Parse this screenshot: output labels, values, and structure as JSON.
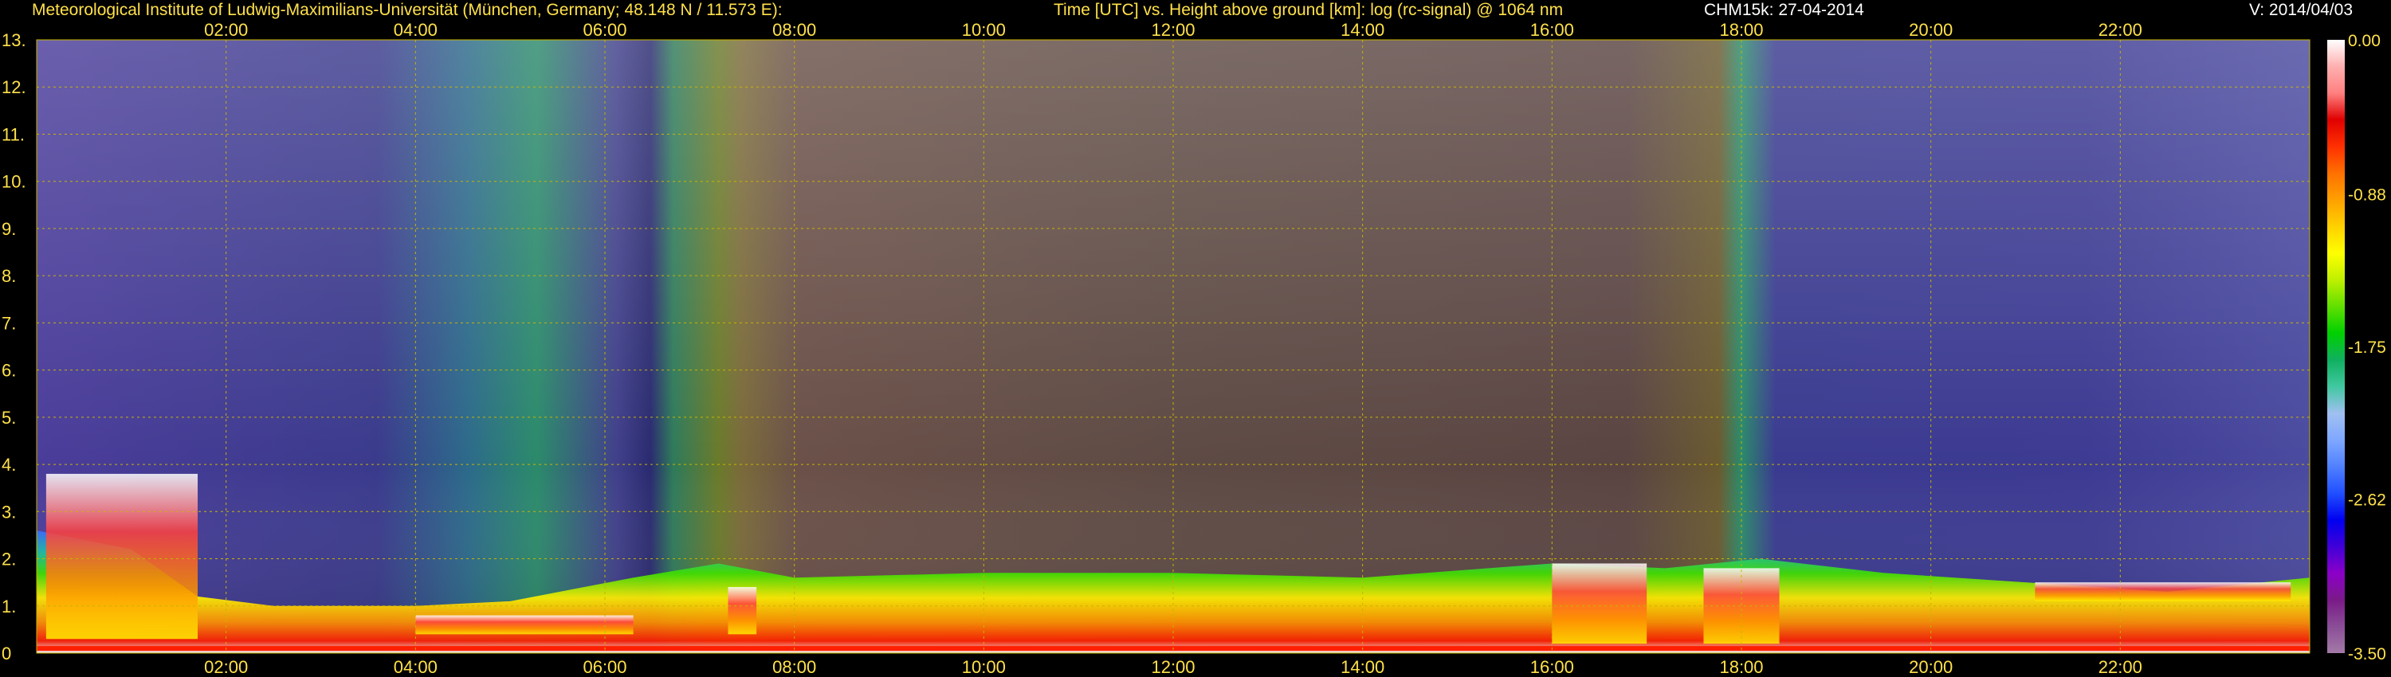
{
  "header": {
    "institute": "Meteorological Institute of Ludwig-Maximilians-Universität (München, Germany; 48.148 N / 11.573 E):",
    "axes_desc": "Time [UTC] vs. Height above ground [km]: log (rc-signal) @ 1064 nm",
    "device": "CHM15k: 27-04-2014",
    "version": "V: 2014/04/03"
  },
  "colors": {
    "axis_text": "#ffe14a",
    "grid": "#c8b400",
    "background": "#000000"
  },
  "chart_data": {
    "type": "heatmap",
    "title": "Time [UTC] vs. Height above ground [km]: log (rc-signal) @ 1064 nm",
    "xlabel": "Time [UTC]",
    "ylabel": "Height above ground [km]",
    "xlim_hours": [
      0,
      24
    ],
    "ylim_km": [
      0,
      13
    ],
    "x_ticks": [
      "02:00",
      "04:00",
      "06:00",
      "08:00",
      "10:00",
      "12:00",
      "14:00",
      "16:00",
      "18:00",
      "20:00",
      "22:00"
    ],
    "x_tick_hours": [
      2,
      4,
      6,
      8,
      10,
      12,
      14,
      16,
      18,
      20,
      22
    ],
    "y_ticks": [
      "0",
      "1.",
      "2.",
      "3.",
      "4.",
      "5.",
      "6.",
      "7.",
      "8.",
      "9.",
      "10.",
      "11.",
      "12.",
      "13."
    ],
    "y_tick_values": [
      0,
      1,
      2,
      3,
      4,
      5,
      6,
      7,
      8,
      9,
      10,
      11,
      12,
      13
    ],
    "grid": true,
    "colorbar": {
      "labels": [
        "0.00",
        "-0.88",
        "-1.75",
        "-2.62",
        "-3.50"
      ],
      "values": [
        0.0,
        -0.88,
        -1.75,
        -2.62,
        -3.5
      ],
      "range": [
        -3.5,
        0.0
      ],
      "colors_low_to_high": [
        "#a47aa8",
        "#8a4e96",
        "#7a1a88",
        "#8c00c8",
        "#4000d8",
        "#0000f0",
        "#2050ff",
        "#5080ff",
        "#80a8ff",
        "#a0c0f0",
        "#40c8a0",
        "#10b060",
        "#00d000",
        "#60e000",
        "#c0f000",
        "#ffff00",
        "#ffd000",
        "#ffa000",
        "#ff7000",
        "#ff3000",
        "#e00000",
        "#ff8080",
        "#ffb0b0",
        "#ffffff"
      ]
    },
    "boundary_layer_top_km": [
      [
        0.0,
        2.6
      ],
      [
        1.0,
        2.2
      ],
      [
        1.7,
        1.2
      ],
      [
        2.5,
        1.0
      ],
      [
        4.0,
        1.0
      ],
      [
        5.0,
        1.1
      ],
      [
        6.3,
        1.6
      ],
      [
        7.2,
        1.9
      ],
      [
        8.0,
        1.6
      ],
      [
        10.0,
        1.7
      ],
      [
        12.0,
        1.7
      ],
      [
        14.0,
        1.6
      ],
      [
        16.0,
        1.9
      ],
      [
        17.2,
        1.8
      ],
      [
        18.2,
        2.0
      ],
      [
        19.5,
        1.7
      ],
      [
        21.0,
        1.5
      ],
      [
        22.5,
        1.3
      ],
      [
        24.0,
        1.6
      ]
    ],
    "cloud_layers": [
      {
        "start": 0.1,
        "end": 1.7,
        "base_km": 0.3,
        "top_km": 3.8
      },
      {
        "start": 4.0,
        "end": 6.3,
        "base_km": 0.4,
        "top_km": 0.8
      },
      {
        "start": 7.3,
        "end": 7.6,
        "base_km": 0.4,
        "top_km": 1.4
      },
      {
        "start": 16.0,
        "end": 17.0,
        "base_km": 0.2,
        "top_km": 1.9
      },
      {
        "start": 17.6,
        "end": 18.4,
        "base_km": 0.2,
        "top_km": 1.8
      },
      {
        "start": 21.1,
        "end": 23.8,
        "base_km": 1.1,
        "top_km": 1.5
      }
    ]
  }
}
